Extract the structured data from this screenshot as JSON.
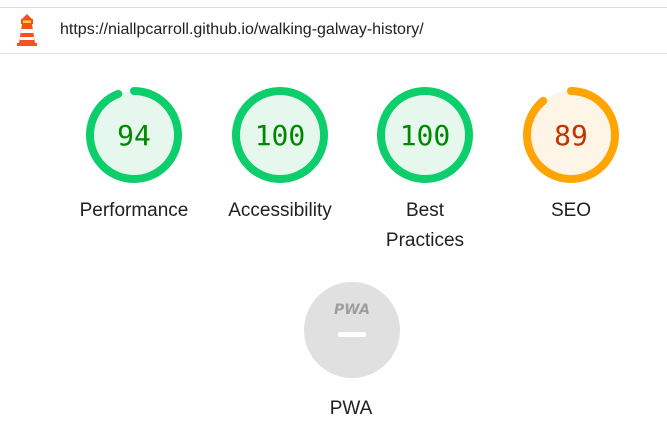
{
  "header": {
    "url": "https://niallpcarroll.github.io/walking-galway-history/"
  },
  "gauges": [
    {
      "label": "Performance",
      "score": "94",
      "value": 94,
      "color": "#0cce6b",
      "fill": "#e6f8ee",
      "text_color": "#008800"
    },
    {
      "label": "Accessibility",
      "score": "100",
      "value": 100,
      "color": "#0cce6b",
      "fill": "#e6f8ee",
      "text_color": "#008800"
    },
    {
      "label": "Best Practices",
      "label_line1": "Best",
      "label_line2": "Practices",
      "score": "100",
      "value": 100,
      "color": "#0cce6b",
      "fill": "#e6f8ee",
      "text_color": "#008800"
    },
    {
      "label": "SEO",
      "score": "89",
      "value": 89,
      "color": "#ffa400",
      "fill": "#fff5e6",
      "text_color": "#c33300"
    }
  ],
  "pwa": {
    "label": "PWA",
    "badge_text": "PWA",
    "color": "#e0e0e0"
  },
  "icons": {
    "logo": "lighthouse-logo-icon",
    "pwa": "pwa-badge-icon"
  }
}
